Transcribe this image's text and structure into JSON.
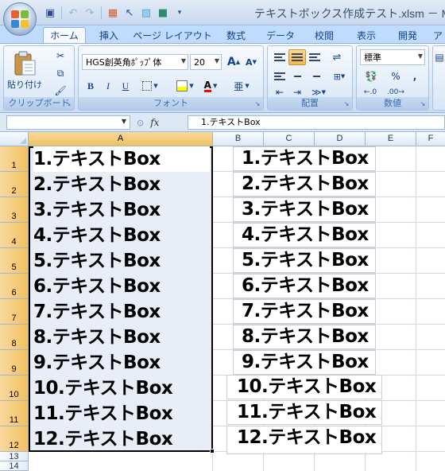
{
  "window": {
    "title": "テキストボックス作成テスト.xlsm － Mic"
  },
  "quick_access": [
    {
      "name": "save-icon",
      "glyph": "▣"
    },
    {
      "name": "undo-icon",
      "glyph": "↶"
    },
    {
      "name": "redo-icon",
      "glyph": "↷"
    },
    {
      "name": "form-icon",
      "glyph": "▦"
    },
    {
      "name": "pointer-icon",
      "glyph": "↖"
    },
    {
      "name": "picture-icon",
      "glyph": "▨"
    },
    {
      "name": "color-icon",
      "glyph": "■"
    },
    {
      "name": "customize-icon",
      "glyph": "▾"
    }
  ],
  "ribbon_tabs": [
    "ホーム",
    "挿入",
    "ページ レイアウト",
    "数式",
    "データ",
    "校閲",
    "表示",
    "開発",
    "ア"
  ],
  "clipboard": {
    "paste_label": "貼り付け",
    "group_label": "クリップボード"
  },
  "font": {
    "name": "HGS創英角ﾎﾟｯﾌﾟ体",
    "size": "20",
    "group_label": "フォント",
    "bold": "B",
    "italic": "I",
    "underline": "U",
    "grow": "A",
    "shrink": "A",
    "phonetic": "亜"
  },
  "alignment": {
    "group_label": "配置"
  },
  "number": {
    "format": "標準",
    "group_label": "数値",
    "percent": "%",
    "comma": ","
  },
  "formula_bar": {
    "fx": "fx",
    "content": "1.テキストBox"
  },
  "columns": [
    "A",
    "B",
    "C",
    "D",
    "E",
    "F"
  ],
  "rows": [
    "1",
    "2",
    "3",
    "4",
    "5",
    "6",
    "7",
    "8",
    "9",
    "10",
    "11",
    "12",
    "13",
    "14"
  ],
  "cells_a": [
    "1.テキストBox",
    "2.テキストBox",
    "3.テキストBox",
    "4.テキストBox",
    "5.テキストBox",
    "6.テキストBox",
    "7.テキストBox",
    "8.テキストBox",
    "9.テキストBox",
    "10.テキストBox",
    "11.テキストBox",
    "12.テキストBox"
  ],
  "textboxes": [
    "1.テキストBox",
    "2.テキストBox",
    "3.テキストBox",
    "4.テキストBox",
    "5.テキストBox",
    "6.テキストBox",
    "7.テキストBox",
    "8.テキストBox",
    "9.テキストBox",
    "10.テキストBox",
    "11.テキストBox",
    "12.テキストBox"
  ],
  "colors": {
    "accent": "#15428b",
    "selection_header": "#f1c15f",
    "grid": "#d0d7e5",
    "ribbon": "#dbe8f7"
  }
}
